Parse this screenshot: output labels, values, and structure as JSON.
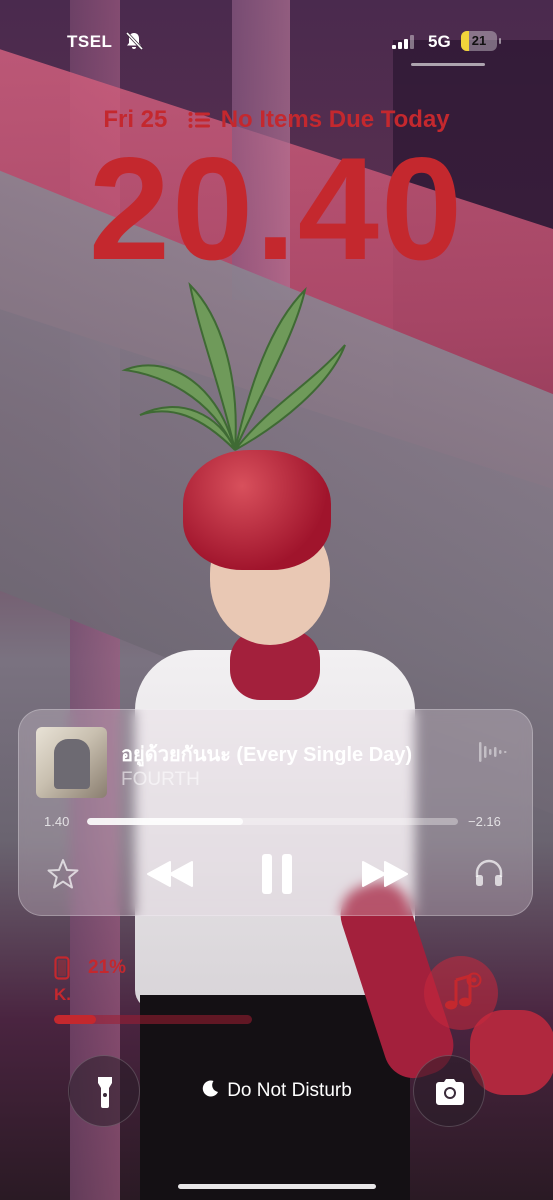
{
  "status_bar": {
    "carrier": "TSEL",
    "network": "5G",
    "battery_level": "21",
    "battery_fraction": 0.21,
    "battery_color": "#f2d33a"
  },
  "lock_screen": {
    "date": "Fri 25",
    "reminders": "No Items Due Today",
    "time": "20.40",
    "accent_color": "#c4282e"
  },
  "now_playing": {
    "title": "อยู่ด้วยกันนะ (Every Single Day)",
    "artist": "FOURTH",
    "elapsed": "1.40",
    "remaining": "−2.16",
    "progress_fraction": 0.42,
    "icons": [
      "waveform-icon",
      "star-icon",
      "rewind-icon",
      "pause-icon",
      "forward-icon",
      "headphones-icon"
    ]
  },
  "battery_widget": {
    "percent": "21%",
    "device": "K.",
    "level_fraction": 0.21
  },
  "bottom": {
    "dnd_label": "Do Not Disturb",
    "icons": [
      "flashlight-icon",
      "moon-icon",
      "camera-icon",
      "music-note-icon"
    ]
  }
}
